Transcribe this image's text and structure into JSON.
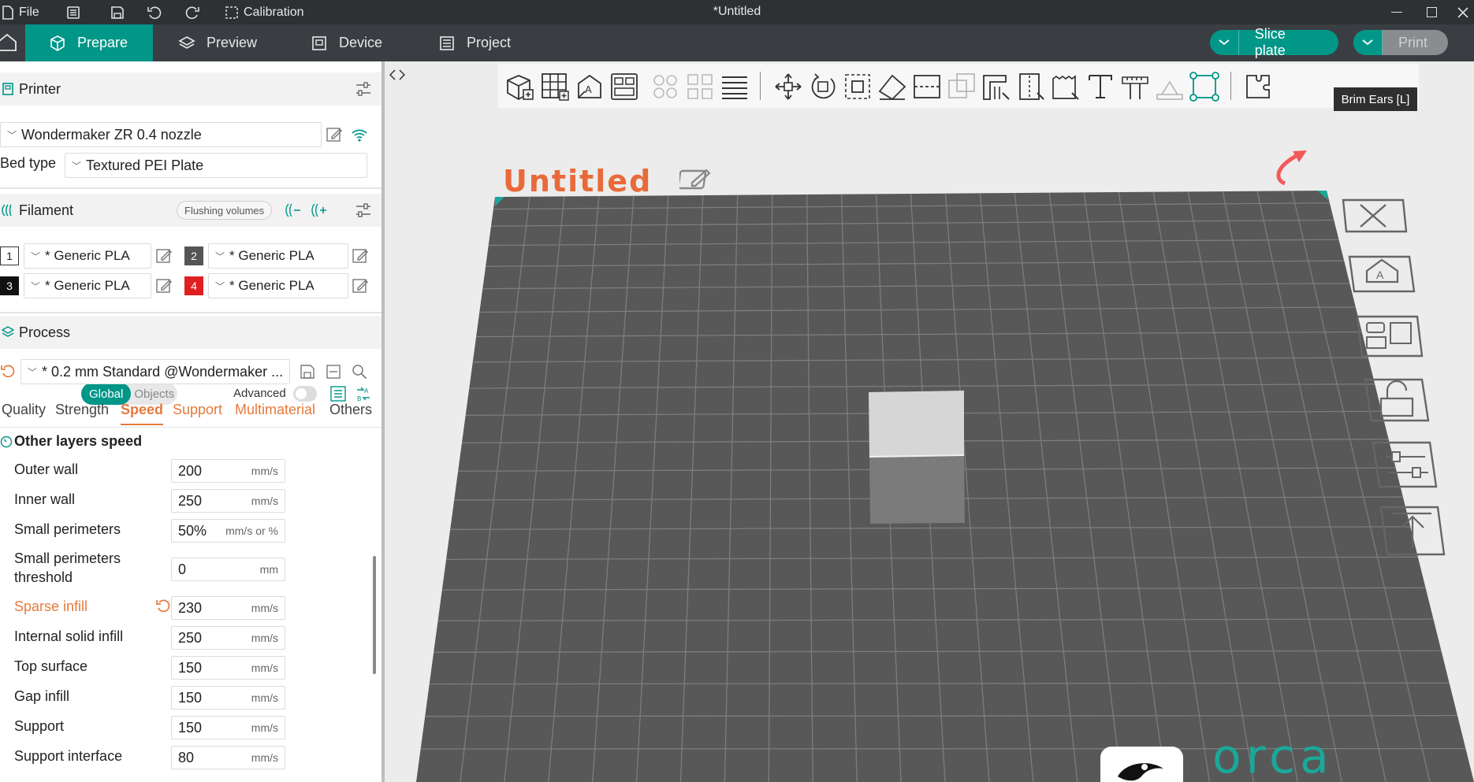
{
  "titlebar": {
    "file_label": "File",
    "calibration_label": "Calibration",
    "window_title": "*Untitled"
  },
  "tabs": [
    {
      "label": "Prepare",
      "icon": "cube-icon",
      "active": true
    },
    {
      "label": "Preview",
      "icon": "layers-icon",
      "active": false
    },
    {
      "label": "Device",
      "icon": "device-icon",
      "active": false
    },
    {
      "label": "Project",
      "icon": "project-icon",
      "active": false
    }
  ],
  "actions": {
    "slice_label": "Slice plate",
    "print_label": "Print"
  },
  "printer": {
    "section_title": "Printer",
    "name": "Wondermaker ZR 0.4 nozzle",
    "bed_type_label": "Bed type",
    "bed_type": "Textured PEI Plate"
  },
  "filament": {
    "section_title": "Filament",
    "flushing_label": "Flushing volumes",
    "slots": [
      {
        "num": "1",
        "name": "* Generic PLA",
        "color": "#ffffff",
        "text_color": "#222222"
      },
      {
        "num": "2",
        "name": "* Generic PLA",
        "color": "#555555",
        "text_color": "#ffffff"
      },
      {
        "num": "3",
        "name": "* Generic PLA",
        "color": "#111111",
        "text_color": "#ffffff"
      },
      {
        "num": "4",
        "name": "* Generic PLA",
        "color": "#e02020",
        "text_color": "#ffffff"
      }
    ]
  },
  "process": {
    "section_title": "Process",
    "global_label": "Global",
    "objects_label": "Objects",
    "advanced_label": "Advanced",
    "preset": "* 0.2 mm  Standard @Wondermaker ..."
  },
  "subtabs": [
    "Quality",
    "Strength",
    "Speed",
    "Support",
    "Multimaterial",
    "Others"
  ],
  "speed": {
    "group_title": "Other layers speed",
    "rows": [
      {
        "label": "Outer wall",
        "value": "200",
        "unit": "mm/s"
      },
      {
        "label": "Inner wall",
        "value": "250",
        "unit": "mm/s"
      },
      {
        "label": "Small perimeters",
        "value": "50%",
        "unit": "mm/s or %"
      },
      {
        "label": "Small perimeters threshold",
        "value": "0",
        "unit": "mm"
      },
      {
        "label": "Sparse infill",
        "value": "230",
        "unit": "mm/s",
        "modified": true
      },
      {
        "label": "Internal solid infill",
        "value": "250",
        "unit": "mm/s"
      },
      {
        "label": "Top surface",
        "value": "150",
        "unit": "mm/s"
      },
      {
        "label": "Gap infill",
        "value": "150",
        "unit": "mm/s"
      },
      {
        "label": "Support",
        "value": "150",
        "unit": "mm/s"
      },
      {
        "label": "Support interface",
        "value": "80",
        "unit": "mm/s"
      }
    ]
  },
  "viewport": {
    "plate_name": "Untitled",
    "tooltip": "Brim Ears [L]",
    "brand_text": "orca"
  },
  "colors": {
    "accent": "#009688",
    "modified": "#e57a3d",
    "bed": "#555555",
    "grid": "#7a7a7a"
  }
}
